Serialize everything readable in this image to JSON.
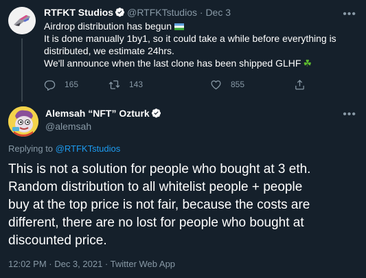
{
  "tweet1": {
    "author_name": "RTFKT Studios",
    "handle": "@RTFKTstudios",
    "separator": "·",
    "date": "Dec 3",
    "more_label": "•••",
    "lines": [
      "Airdrop distribution has begun",
      "It is done manually 1by1, so it could take a while before everything is",
      "distributed, we estimate 24hrs.",
      "We'll announce when the last clone has been shipped  GLHF"
    ],
    "emoji_line1": "flag-emoji",
    "emoji_line4": "four-leaf-clover-emoji",
    "reply_count": "165",
    "retweet_count": "143",
    "like_count": "855"
  },
  "tweet2": {
    "author_name": "Alemsah “NFT” Ozturk",
    "handle": "@alemsah",
    "more_label": "•••",
    "replying_prefix": "Replying to",
    "replying_handle": "@RTFKTstudios",
    "lines": [
      "This is not a solution for people who bought at 3 eth.",
      "Random distribution to all whitelist people + people",
      "buy at the top price is not fair, because the costs are",
      "different, there are no lost for people who bought at",
      "discounted price."
    ],
    "meta": "12:02 PM · Dec 3, 2021 · Twitter Web App"
  },
  "colors": {
    "background": "#15202b",
    "text": "#ffffff",
    "muted": "#8899a6",
    "link": "#1d9bf0",
    "verified": "#ffffff",
    "thread_line": "#38444d"
  },
  "icons": [
    "verified-badge-icon",
    "more-icon",
    "reply-icon",
    "retweet-icon",
    "like-icon",
    "share-icon"
  ]
}
